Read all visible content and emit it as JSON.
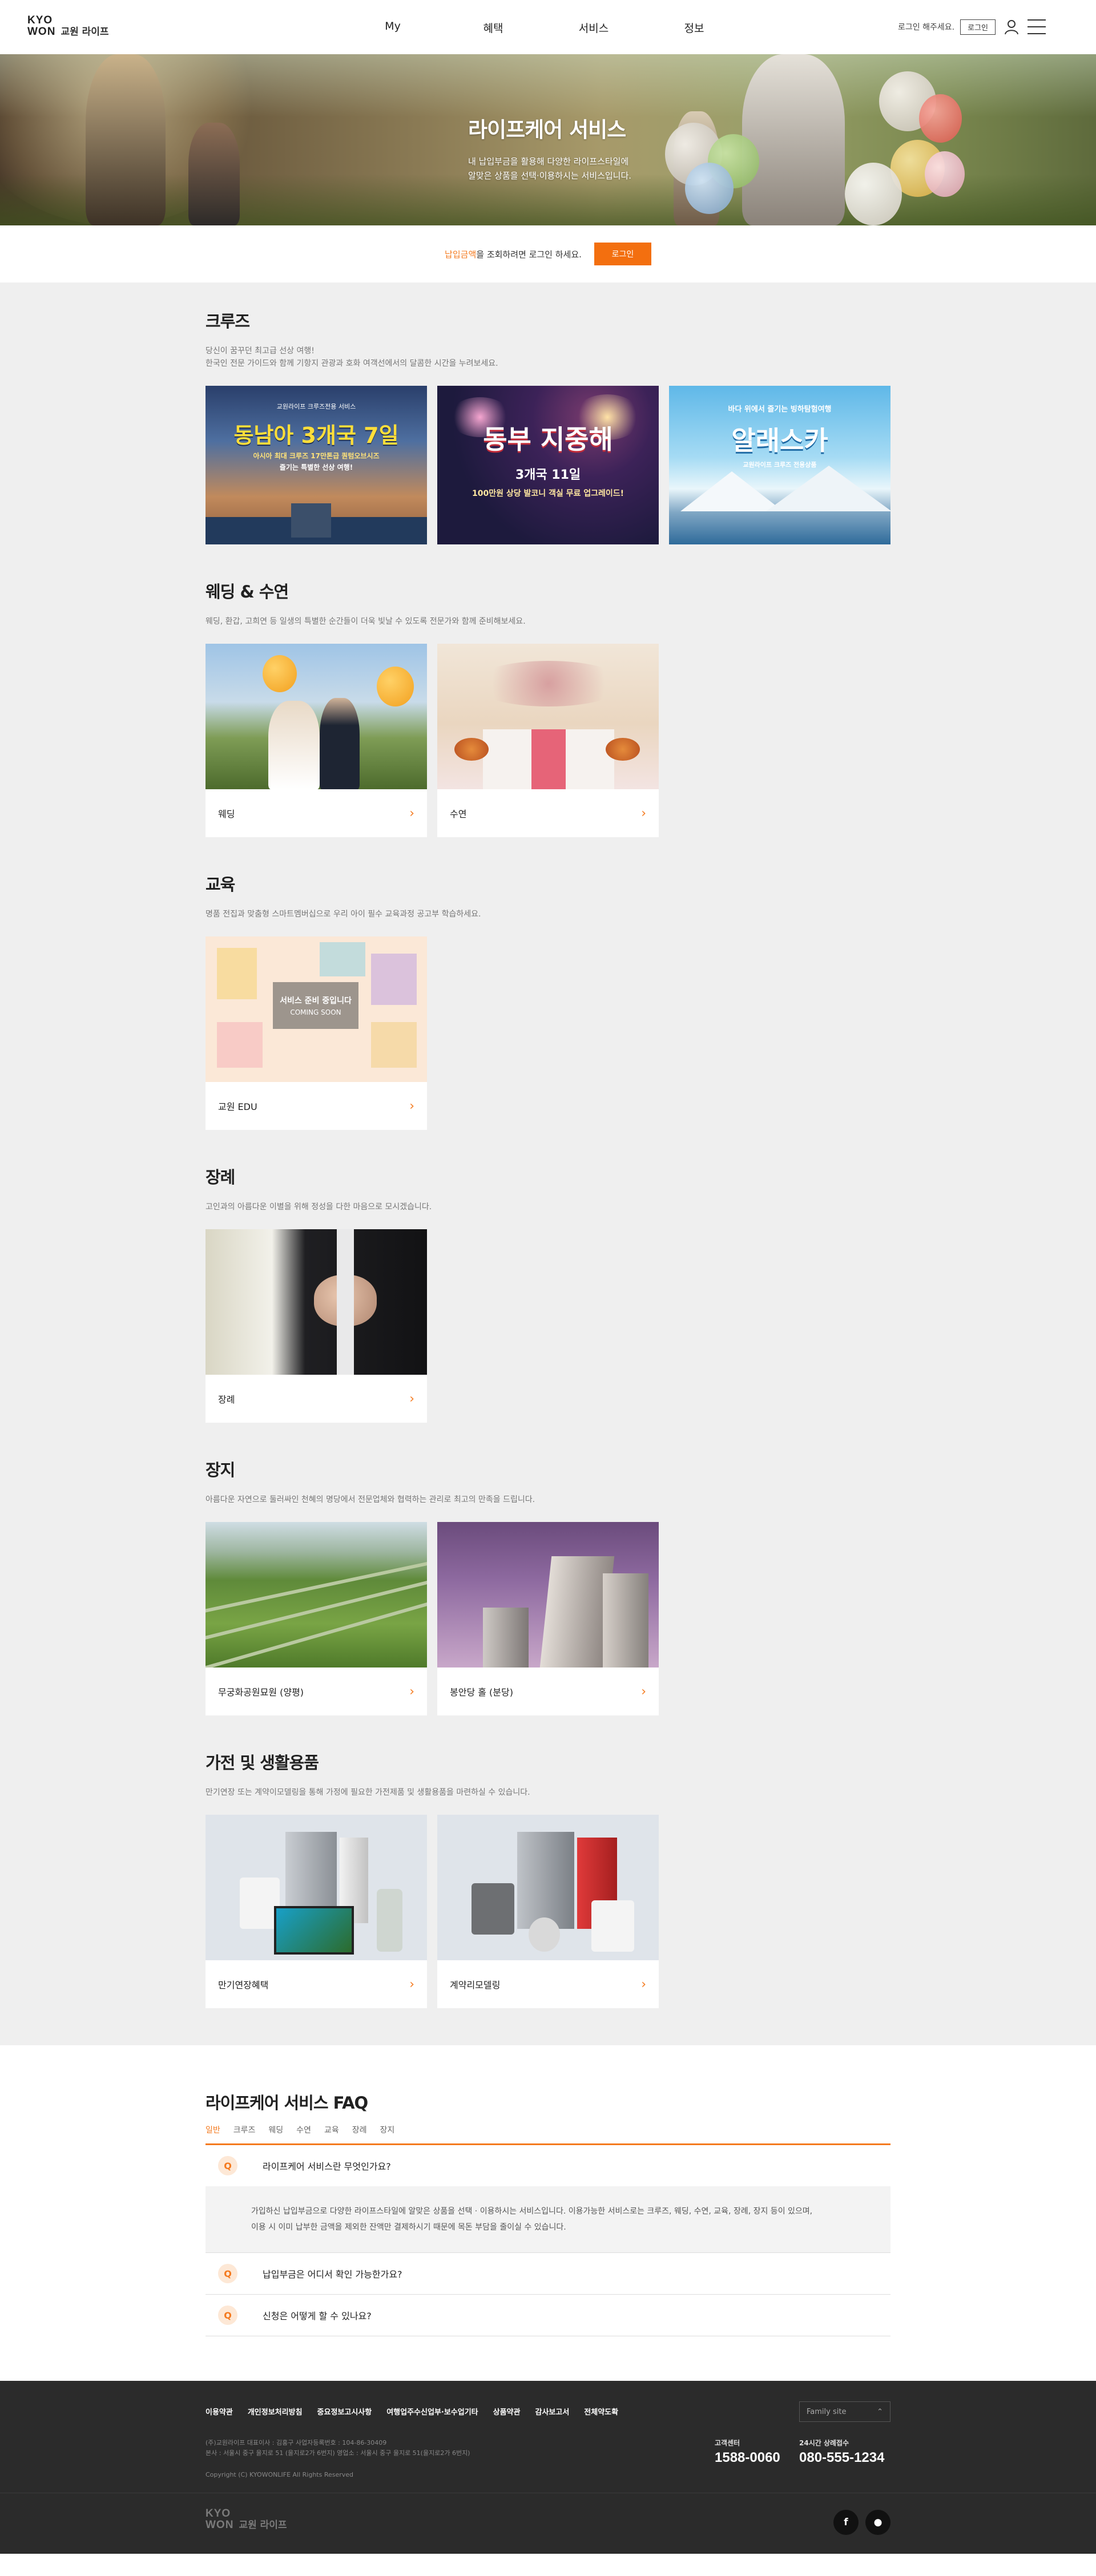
{
  "header": {
    "logo_top": "KYO",
    "logo_bottom": "WON",
    "logo_kr": "교원 라이프",
    "nav": [
      "My",
      "혜택",
      "서비스",
      "정보"
    ],
    "login_msg": "로그인 해주세요.",
    "login_label": "로그인"
  },
  "hero": {
    "title": "라이프케어 서비스",
    "desc1": "내 납입부금을 활용해 다양한 라이프스타일에",
    "desc2": "알맞은 상품을 선택·이용하시는 서비스입니다."
  },
  "notice": {
    "highlight": "납입금액",
    "text": "을 조회하려면 로그인 하세요.",
    "button": "로그인"
  },
  "sections": {
    "cruise": {
      "title": "크루즈",
      "desc1": "당신이 꿈꾸던 최고급 선상 여행!",
      "desc2": "한국인 전문 가이드와 함께 기항지 관광과 호화 여객선에서의 달콤한 시간을 누려보세요.",
      "banners": [
        {
          "small": "교원라이프 크루즈전용 서비스",
          "big": "동남아 3개국 7일",
          "sub1": "아시아 최대 크루즈 17만톤급 퀀텀오브시즈",
          "sub2": "즐기는 특별한 선상 여행!"
        },
        {
          "big": "동부 지중해",
          "sub1": "3개국 11일",
          "sub2": "100만원 상당 발코니 객실 무료 업그레이드!"
        },
        {
          "small": "바다 위에서 즐기는 빙하탐험여행",
          "big": "알래스카",
          "sub1": "교원라이프 크루즈 전용상품"
        }
      ]
    },
    "wedding": {
      "title": "웨딩 & 수연",
      "desc1": "웨딩, 환갑, 고희연 등 일생의 특별한 순간들이 더욱 빛날 수 있도록 전문가와 함께 준비해보세요.",
      "cards": [
        "웨딩",
        "수연"
      ]
    },
    "edu": {
      "title": "교육",
      "desc1": "명품 전집과 맞춤형 스마트멤버십으로 우리 아이 필수 교육과정 공고부 학습하세요.",
      "coming1": "서비스 준비 중입니다",
      "coming2": "COMING SOON",
      "cards": [
        "교원 EDU"
      ]
    },
    "funeral": {
      "title": "장례",
      "desc1": "고인과의 아름다운 이별을 위해 정성을 다한 마음으로 모시겠습니다.",
      "cards": [
        "장례"
      ]
    },
    "burial": {
      "title": "장지",
      "desc1": "아름다운 자연으로 둘러싸인 천혜의 명당에서 전문업체와 협력하는 관리로 최고의 만족을 드립니다.",
      "cards": [
        "무궁화공원묘원 (양평)",
        "봉안당 홀 (분당)"
      ]
    },
    "appliance": {
      "title": "가전 및 생활용품",
      "desc1": "만기연장 또는 계약이모델링을 통해 가정에 필요한 가전제품 및 생활용품을 마련하실 수 있습니다.",
      "cards": [
        "만기연장혜택",
        "계약리모델링"
      ]
    }
  },
  "faq": {
    "title": "라이프케어 서비스 FAQ",
    "tabs": [
      "일반",
      "크루즈",
      "웨딩",
      "수연",
      "교육",
      "장례",
      "장지"
    ],
    "items": [
      {
        "badge": "Q",
        "q": "라이프케어 서비스란 무엇인가요?",
        "a1": "가입하신 납입부금으로 다양한 라이프스타일에 알맞은 상품을 선택 · 이용하시는 서비스입니다. 이용가능한 서비스로는 크루즈, 웨딩, 수연, 교육, 장례, 장지 등이 있으며,",
        "a2": "이용 시 이미 납부한 금액을 제외한 잔액만 결제하시기 때문에 목돈 부담을 줄이실 수 있습니다."
      },
      {
        "badge": "Q",
        "q": "납입부금은 어디서 확인 가능한가요?"
      },
      {
        "badge": "Q",
        "q": "신청은 어떻게 할 수 있나요?"
      }
    ]
  },
  "footer": {
    "links": [
      "이용약관",
      "개인정보처리방침",
      "중요정보고시사항",
      "여행업주수신업부·보수업기타",
      "상품약관",
      "감사보고서",
      "전체약도확"
    ],
    "info1": "(주)교원라이프 대표이사 : 김홍구 사업자등록번호 : 104-86-30409",
    "info2": "본사 : 서울시 중구 을지로 51 (을지로2가 6번지) 영업소 : 서울시 중구 을지로 51(을지로2가 6번지)",
    "copyright": "Copyright (C) KYOWONLIFE All Rights Reserved",
    "family": "Family site",
    "cs1_label": "고객센터",
    "cs1_num": "1588-0060",
    "cs2_label": "24시간 상례접수",
    "cs2_num": "080-555-1234",
    "logo_top": "KYO",
    "logo_bottom": "WON",
    "logo_kr": "교원 라이프",
    "sns1": "f",
    "sns2": "●"
  },
  "colors": {
    "accent": "#f47a1f",
    "button": "#f36f0f",
    "content_bg": "#efefef",
    "footer_bg": "#2b2b2b"
  }
}
